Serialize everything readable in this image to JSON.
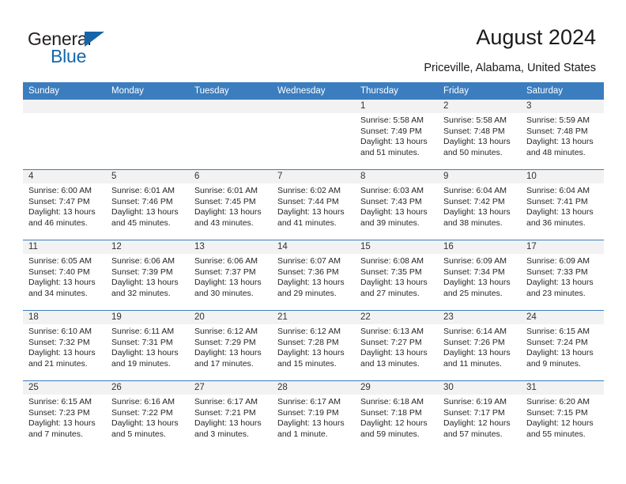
{
  "brand": {
    "name_dark": "General",
    "name_blue": "Blue",
    "accent_color": "#1368ad",
    "header_color": "#3b7dbf"
  },
  "header": {
    "title": "August 2024",
    "subtitle": "Priceville, Alabama, United States"
  },
  "weekdays": [
    "Sunday",
    "Monday",
    "Tuesday",
    "Wednesday",
    "Thursday",
    "Friday",
    "Saturday"
  ],
  "weeks": [
    [
      {
        "day": "",
        "sunrise": "",
        "sunset": "",
        "daylight": "",
        "daylight2": ""
      },
      {
        "day": "",
        "sunrise": "",
        "sunset": "",
        "daylight": "",
        "daylight2": ""
      },
      {
        "day": "",
        "sunrise": "",
        "sunset": "",
        "daylight": "",
        "daylight2": ""
      },
      {
        "day": "",
        "sunrise": "",
        "sunset": "",
        "daylight": "",
        "daylight2": ""
      },
      {
        "day": "1",
        "sunrise": "Sunrise: 5:58 AM",
        "sunset": "Sunset: 7:49 PM",
        "daylight": "Daylight: 13 hours",
        "daylight2": "and 51 minutes."
      },
      {
        "day": "2",
        "sunrise": "Sunrise: 5:58 AM",
        "sunset": "Sunset: 7:48 PM",
        "daylight": "Daylight: 13 hours",
        "daylight2": "and 50 minutes."
      },
      {
        "day": "3",
        "sunrise": "Sunrise: 5:59 AM",
        "sunset": "Sunset: 7:48 PM",
        "daylight": "Daylight: 13 hours",
        "daylight2": "and 48 minutes."
      }
    ],
    [
      {
        "day": "4",
        "sunrise": "Sunrise: 6:00 AM",
        "sunset": "Sunset: 7:47 PM",
        "daylight": "Daylight: 13 hours",
        "daylight2": "and 46 minutes."
      },
      {
        "day": "5",
        "sunrise": "Sunrise: 6:01 AM",
        "sunset": "Sunset: 7:46 PM",
        "daylight": "Daylight: 13 hours",
        "daylight2": "and 45 minutes."
      },
      {
        "day": "6",
        "sunrise": "Sunrise: 6:01 AM",
        "sunset": "Sunset: 7:45 PM",
        "daylight": "Daylight: 13 hours",
        "daylight2": "and 43 minutes."
      },
      {
        "day": "7",
        "sunrise": "Sunrise: 6:02 AM",
        "sunset": "Sunset: 7:44 PM",
        "daylight": "Daylight: 13 hours",
        "daylight2": "and 41 minutes."
      },
      {
        "day": "8",
        "sunrise": "Sunrise: 6:03 AM",
        "sunset": "Sunset: 7:43 PM",
        "daylight": "Daylight: 13 hours",
        "daylight2": "and 39 minutes."
      },
      {
        "day": "9",
        "sunrise": "Sunrise: 6:04 AM",
        "sunset": "Sunset: 7:42 PM",
        "daylight": "Daylight: 13 hours",
        "daylight2": "and 38 minutes."
      },
      {
        "day": "10",
        "sunrise": "Sunrise: 6:04 AM",
        "sunset": "Sunset: 7:41 PM",
        "daylight": "Daylight: 13 hours",
        "daylight2": "and 36 minutes."
      }
    ],
    [
      {
        "day": "11",
        "sunrise": "Sunrise: 6:05 AM",
        "sunset": "Sunset: 7:40 PM",
        "daylight": "Daylight: 13 hours",
        "daylight2": "and 34 minutes."
      },
      {
        "day": "12",
        "sunrise": "Sunrise: 6:06 AM",
        "sunset": "Sunset: 7:39 PM",
        "daylight": "Daylight: 13 hours",
        "daylight2": "and 32 minutes."
      },
      {
        "day": "13",
        "sunrise": "Sunrise: 6:06 AM",
        "sunset": "Sunset: 7:37 PM",
        "daylight": "Daylight: 13 hours",
        "daylight2": "and 30 minutes."
      },
      {
        "day": "14",
        "sunrise": "Sunrise: 6:07 AM",
        "sunset": "Sunset: 7:36 PM",
        "daylight": "Daylight: 13 hours",
        "daylight2": "and 29 minutes."
      },
      {
        "day": "15",
        "sunrise": "Sunrise: 6:08 AM",
        "sunset": "Sunset: 7:35 PM",
        "daylight": "Daylight: 13 hours",
        "daylight2": "and 27 minutes."
      },
      {
        "day": "16",
        "sunrise": "Sunrise: 6:09 AM",
        "sunset": "Sunset: 7:34 PM",
        "daylight": "Daylight: 13 hours",
        "daylight2": "and 25 minutes."
      },
      {
        "day": "17",
        "sunrise": "Sunrise: 6:09 AM",
        "sunset": "Sunset: 7:33 PM",
        "daylight": "Daylight: 13 hours",
        "daylight2": "and 23 minutes."
      }
    ],
    [
      {
        "day": "18",
        "sunrise": "Sunrise: 6:10 AM",
        "sunset": "Sunset: 7:32 PM",
        "daylight": "Daylight: 13 hours",
        "daylight2": "and 21 minutes."
      },
      {
        "day": "19",
        "sunrise": "Sunrise: 6:11 AM",
        "sunset": "Sunset: 7:31 PM",
        "daylight": "Daylight: 13 hours",
        "daylight2": "and 19 minutes."
      },
      {
        "day": "20",
        "sunrise": "Sunrise: 6:12 AM",
        "sunset": "Sunset: 7:29 PM",
        "daylight": "Daylight: 13 hours",
        "daylight2": "and 17 minutes."
      },
      {
        "day": "21",
        "sunrise": "Sunrise: 6:12 AM",
        "sunset": "Sunset: 7:28 PM",
        "daylight": "Daylight: 13 hours",
        "daylight2": "and 15 minutes."
      },
      {
        "day": "22",
        "sunrise": "Sunrise: 6:13 AM",
        "sunset": "Sunset: 7:27 PM",
        "daylight": "Daylight: 13 hours",
        "daylight2": "and 13 minutes."
      },
      {
        "day": "23",
        "sunrise": "Sunrise: 6:14 AM",
        "sunset": "Sunset: 7:26 PM",
        "daylight": "Daylight: 13 hours",
        "daylight2": "and 11 minutes."
      },
      {
        "day": "24",
        "sunrise": "Sunrise: 6:15 AM",
        "sunset": "Sunset: 7:24 PM",
        "daylight": "Daylight: 13 hours",
        "daylight2": "and 9 minutes."
      }
    ],
    [
      {
        "day": "25",
        "sunrise": "Sunrise: 6:15 AM",
        "sunset": "Sunset: 7:23 PM",
        "daylight": "Daylight: 13 hours",
        "daylight2": "and 7 minutes."
      },
      {
        "day": "26",
        "sunrise": "Sunrise: 6:16 AM",
        "sunset": "Sunset: 7:22 PM",
        "daylight": "Daylight: 13 hours",
        "daylight2": "and 5 minutes."
      },
      {
        "day": "27",
        "sunrise": "Sunrise: 6:17 AM",
        "sunset": "Sunset: 7:21 PM",
        "daylight": "Daylight: 13 hours",
        "daylight2": "and 3 minutes."
      },
      {
        "day": "28",
        "sunrise": "Sunrise: 6:17 AM",
        "sunset": "Sunset: 7:19 PM",
        "daylight": "Daylight: 13 hours",
        "daylight2": "and 1 minute."
      },
      {
        "day": "29",
        "sunrise": "Sunrise: 6:18 AM",
        "sunset": "Sunset: 7:18 PM",
        "daylight": "Daylight: 12 hours",
        "daylight2": "and 59 minutes."
      },
      {
        "day": "30",
        "sunrise": "Sunrise: 6:19 AM",
        "sunset": "Sunset: 7:17 PM",
        "daylight": "Daylight: 12 hours",
        "daylight2": "and 57 minutes."
      },
      {
        "day": "31",
        "sunrise": "Sunrise: 6:20 AM",
        "sunset": "Sunset: 7:15 PM",
        "daylight": "Daylight: 12 hours",
        "daylight2": "and 55 minutes."
      }
    ]
  ]
}
